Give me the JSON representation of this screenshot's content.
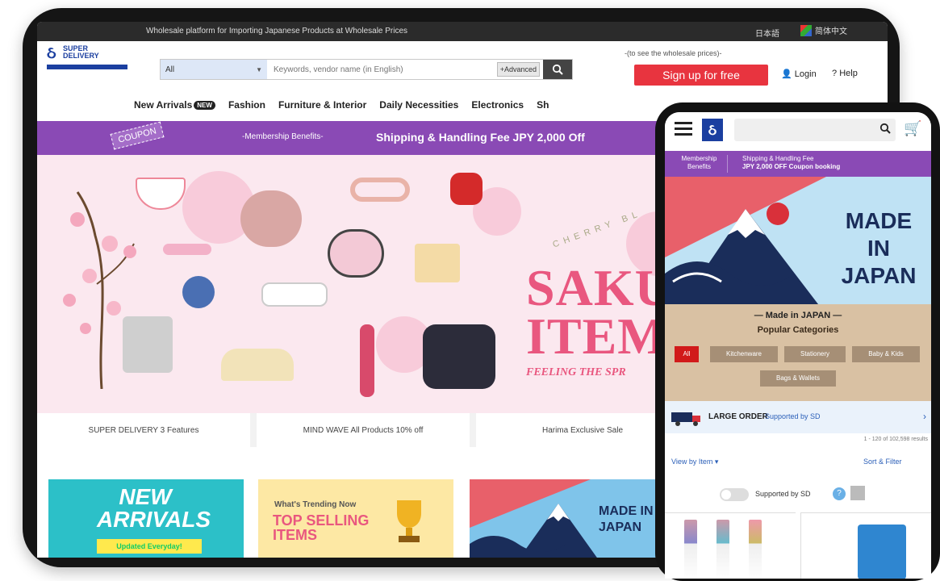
{
  "desktop": {
    "topbar": {
      "tagline": "Wholesale platform for Importing Japanese Products at Wholesale Prices",
      "language": "日本語",
      "language_alt": "简体中文"
    },
    "logo": {
      "line1": "SUPER",
      "line2": "DELIVERY"
    },
    "search": {
      "category": "All",
      "placeholder": "Keywords, vendor name (in English)",
      "advanced_label": "+Advanced"
    },
    "signup_hint": "-(to see the wholesale prices)-",
    "signup_label": "Sign up for free",
    "login_label": "Login",
    "help_label": "Help",
    "nav": [
      {
        "label": "New Arrivals",
        "badge": "NEW"
      },
      {
        "label": "Fashion"
      },
      {
        "label": "Furniture & Interior"
      },
      {
        "label": "Daily Necessities"
      },
      {
        "label": "Electronics"
      },
      {
        "label": "Sh"
      }
    ],
    "promo": {
      "coupon": "COUPON",
      "membership": "-Membership Benefits-",
      "shipping": "Shipping & Handling Fee  JPY 2,000 Off"
    },
    "hero": {
      "headline_line1": "SAKU",
      "headline_line2": "ITEM",
      "subline": "FEELING THE SPR",
      "arc_text": "CHERRY BL"
    },
    "feature_tabs": [
      "SUPER DELIVERY 3 Features",
      "MIND WAVE All Products 10% off",
      "Harima Exclusive Sale"
    ],
    "tiles": {
      "new_arrivals_title": "NEW ARRIVALS",
      "new_arrivals_sub": "Updated Everyday!",
      "trending_label": "What's Trending Now",
      "top_selling": "TOP SELLING ITEMS",
      "made_in_japan": "MADE IN JAPAN"
    }
  },
  "mobile": {
    "promo": {
      "membership": "Membership Benefits",
      "shipping_line1": "Shipping & Handling Fee",
      "shipping_line2": "JPY 2,000 OFF Coupon booking"
    },
    "hero_title": "MADE IN JAPAN",
    "made_in_japan_heading": "— Made in JAPAN —",
    "popular_categories": "Popular Categories",
    "category_chips": [
      "All",
      "Kitchenware",
      "Stationery",
      "Baby & Kids",
      "Bags & Wallets"
    ],
    "large_order": "LARGE ORDER",
    "supported_by": "Supported by SD",
    "results_count": "1 - 120 of 102,598 results",
    "view_by": "View by Item",
    "sort_filter": "Sort & Filter",
    "supported_toggle": "Supported by SD"
  },
  "colors": {
    "brand_blue": "#1b3fa0",
    "signup_red": "#e8343f",
    "promo_purple": "#8a4ab5",
    "sakura_pink": "#e9577f"
  }
}
